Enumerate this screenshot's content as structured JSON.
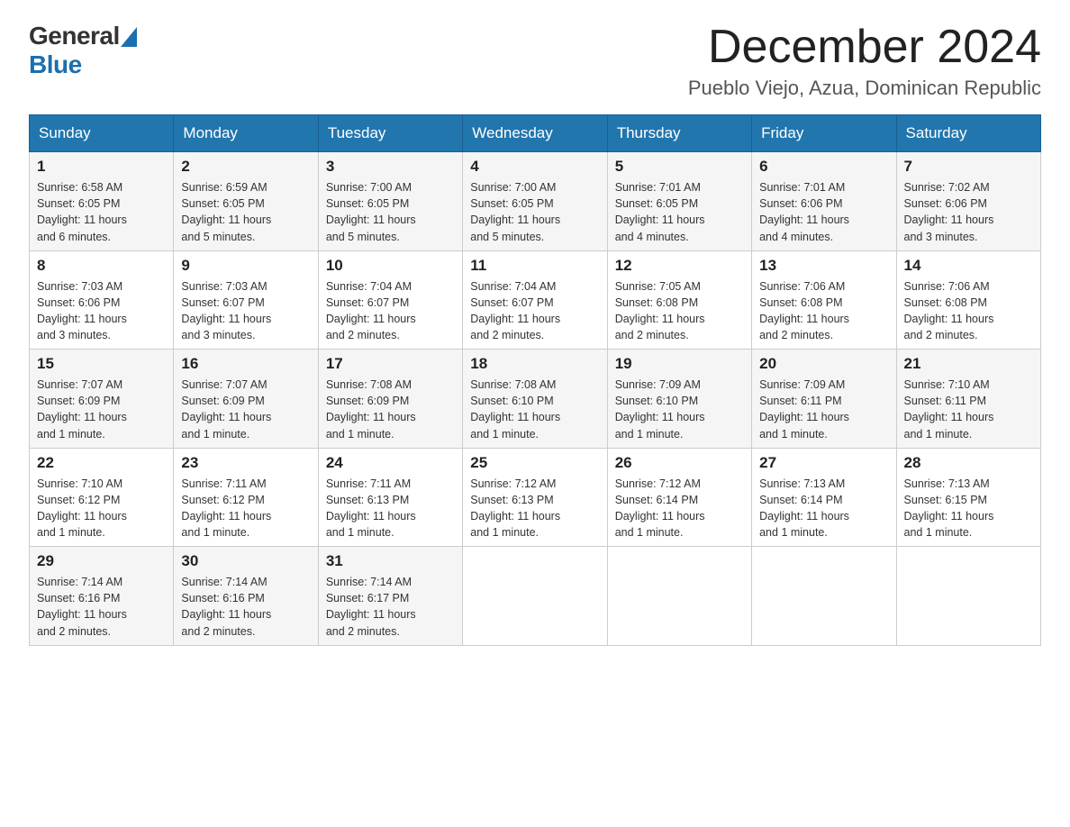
{
  "logo": {
    "general": "General",
    "blue": "Blue"
  },
  "title": "December 2024",
  "subtitle": "Pueblo Viejo, Azua, Dominican Republic",
  "weekdays": [
    "Sunday",
    "Monday",
    "Tuesday",
    "Wednesday",
    "Thursday",
    "Friday",
    "Saturday"
  ],
  "weeks": [
    [
      {
        "day": "1",
        "sunrise": "6:58 AM",
        "sunset": "6:05 PM",
        "daylight": "11 hours and 6 minutes."
      },
      {
        "day": "2",
        "sunrise": "6:59 AM",
        "sunset": "6:05 PM",
        "daylight": "11 hours and 5 minutes."
      },
      {
        "day": "3",
        "sunrise": "7:00 AM",
        "sunset": "6:05 PM",
        "daylight": "11 hours and 5 minutes."
      },
      {
        "day": "4",
        "sunrise": "7:00 AM",
        "sunset": "6:05 PM",
        "daylight": "11 hours and 5 minutes."
      },
      {
        "day": "5",
        "sunrise": "7:01 AM",
        "sunset": "6:05 PM",
        "daylight": "11 hours and 4 minutes."
      },
      {
        "day": "6",
        "sunrise": "7:01 AM",
        "sunset": "6:06 PM",
        "daylight": "11 hours and 4 minutes."
      },
      {
        "day": "7",
        "sunrise": "7:02 AM",
        "sunset": "6:06 PM",
        "daylight": "11 hours and 3 minutes."
      }
    ],
    [
      {
        "day": "8",
        "sunrise": "7:03 AM",
        "sunset": "6:06 PM",
        "daylight": "11 hours and 3 minutes."
      },
      {
        "day": "9",
        "sunrise": "7:03 AM",
        "sunset": "6:07 PM",
        "daylight": "11 hours and 3 minutes."
      },
      {
        "day": "10",
        "sunrise": "7:04 AM",
        "sunset": "6:07 PM",
        "daylight": "11 hours and 2 minutes."
      },
      {
        "day": "11",
        "sunrise": "7:04 AM",
        "sunset": "6:07 PM",
        "daylight": "11 hours and 2 minutes."
      },
      {
        "day": "12",
        "sunrise": "7:05 AM",
        "sunset": "6:08 PM",
        "daylight": "11 hours and 2 minutes."
      },
      {
        "day": "13",
        "sunrise": "7:06 AM",
        "sunset": "6:08 PM",
        "daylight": "11 hours and 2 minutes."
      },
      {
        "day": "14",
        "sunrise": "7:06 AM",
        "sunset": "6:08 PM",
        "daylight": "11 hours and 2 minutes."
      }
    ],
    [
      {
        "day": "15",
        "sunrise": "7:07 AM",
        "sunset": "6:09 PM",
        "daylight": "11 hours and 1 minute."
      },
      {
        "day": "16",
        "sunrise": "7:07 AM",
        "sunset": "6:09 PM",
        "daylight": "11 hours and 1 minute."
      },
      {
        "day": "17",
        "sunrise": "7:08 AM",
        "sunset": "6:09 PM",
        "daylight": "11 hours and 1 minute."
      },
      {
        "day": "18",
        "sunrise": "7:08 AM",
        "sunset": "6:10 PM",
        "daylight": "11 hours and 1 minute."
      },
      {
        "day": "19",
        "sunrise": "7:09 AM",
        "sunset": "6:10 PM",
        "daylight": "11 hours and 1 minute."
      },
      {
        "day": "20",
        "sunrise": "7:09 AM",
        "sunset": "6:11 PM",
        "daylight": "11 hours and 1 minute."
      },
      {
        "day": "21",
        "sunrise": "7:10 AM",
        "sunset": "6:11 PM",
        "daylight": "11 hours and 1 minute."
      }
    ],
    [
      {
        "day": "22",
        "sunrise": "7:10 AM",
        "sunset": "6:12 PM",
        "daylight": "11 hours and 1 minute."
      },
      {
        "day": "23",
        "sunrise": "7:11 AM",
        "sunset": "6:12 PM",
        "daylight": "11 hours and 1 minute."
      },
      {
        "day": "24",
        "sunrise": "7:11 AM",
        "sunset": "6:13 PM",
        "daylight": "11 hours and 1 minute."
      },
      {
        "day": "25",
        "sunrise": "7:12 AM",
        "sunset": "6:13 PM",
        "daylight": "11 hours and 1 minute."
      },
      {
        "day": "26",
        "sunrise": "7:12 AM",
        "sunset": "6:14 PM",
        "daylight": "11 hours and 1 minute."
      },
      {
        "day": "27",
        "sunrise": "7:13 AM",
        "sunset": "6:14 PM",
        "daylight": "11 hours and 1 minute."
      },
      {
        "day": "28",
        "sunrise": "7:13 AM",
        "sunset": "6:15 PM",
        "daylight": "11 hours and 1 minute."
      }
    ],
    [
      {
        "day": "29",
        "sunrise": "7:14 AM",
        "sunset": "6:16 PM",
        "daylight": "11 hours and 2 minutes."
      },
      {
        "day": "30",
        "sunrise": "7:14 AM",
        "sunset": "6:16 PM",
        "daylight": "11 hours and 2 minutes."
      },
      {
        "day": "31",
        "sunrise": "7:14 AM",
        "sunset": "6:17 PM",
        "daylight": "11 hours and 2 minutes."
      },
      null,
      null,
      null,
      null
    ]
  ],
  "labels": {
    "sunrise": "Sunrise:",
    "sunset": "Sunset:",
    "daylight": "Daylight:"
  }
}
